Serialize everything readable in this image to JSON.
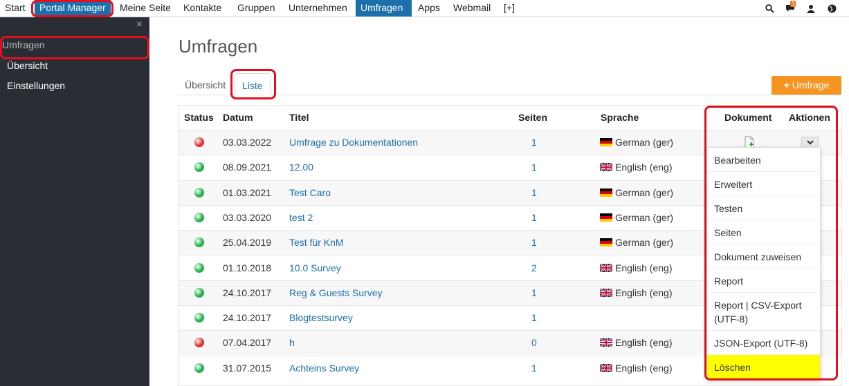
{
  "nav": {
    "items": [
      "Start",
      "Portal Manager",
      "Meine Seite",
      "Kontakte",
      "Gruppen",
      "Unternehmen",
      "Umfragen",
      "Apps",
      "Webmail",
      "[+]"
    ],
    "notification_count": "1",
    "icons": [
      "zoom-icon",
      "chat-icon",
      "user-icon",
      "globe-icon"
    ]
  },
  "sidebar": {
    "close": "×",
    "title": "Umfragen",
    "links": [
      "Übersicht",
      "Einstellungen"
    ]
  },
  "page": {
    "title": "Umfragen",
    "tabs": [
      "Übersicht",
      "Liste"
    ],
    "add_button": "Umfrage",
    "add_plus": "+"
  },
  "table": {
    "headers": [
      "Status",
      "Datum",
      "Titel",
      "Seiten",
      "Sprache",
      "Dokument",
      "Aktionen"
    ],
    "rows": [
      {
        "status": "red",
        "date": "03.03.2022",
        "title": "Umfrage zu Dokumentationen",
        "pages": "1",
        "lang": "German (ger)",
        "flag": "de"
      },
      {
        "status": "green",
        "date": "08.09.2021",
        "title": "12.00",
        "pages": "1",
        "lang": "English (eng)",
        "flag": "en"
      },
      {
        "status": "green",
        "date": "01.03.2021",
        "title": "Test Caro",
        "pages": "1",
        "lang": "German (ger)",
        "flag": "de"
      },
      {
        "status": "green",
        "date": "03.03.2020",
        "title": "test 2",
        "pages": "1",
        "lang": "German (ger)",
        "flag": "de"
      },
      {
        "status": "green",
        "date": "25.04.2019",
        "title": "Test für KnM",
        "pages": "1",
        "lang": "German (ger)",
        "flag": "de"
      },
      {
        "status": "green",
        "date": "01.10.2018",
        "title": "10.0 Survey",
        "pages": "2",
        "lang": "English (eng)",
        "flag": "en"
      },
      {
        "status": "green",
        "date": "24.10.2017",
        "title": "Reg & Guests Survey",
        "pages": "1",
        "lang": "English (eng)",
        "flag": "en"
      },
      {
        "status": "green",
        "date": "24.10.2017",
        "title": "Blogtestsurvey",
        "pages": "1",
        "lang": "",
        "flag": ""
      },
      {
        "status": "red",
        "date": "07.04.2017",
        "title": "h",
        "pages": "0",
        "lang": "English (eng)",
        "flag": "en"
      },
      {
        "status": "green",
        "date": "31.07.2015",
        "title": "Achteins Survey",
        "pages": "1",
        "lang": "English (eng)",
        "flag": "en"
      }
    ]
  },
  "dropdown": {
    "items": [
      "Bearbeiten",
      "Erweitert",
      "Testen",
      "Seiten",
      "Dokument zuweisen",
      "Report",
      "Report | CSV-Export (UTF-8)",
      "JSON-Export (UTF-8)",
      "Löschen"
    ]
  },
  "colors": {
    "accent": "#1b6faa",
    "orange": "#f59420",
    "status_red": "#e03030",
    "status_green": "#22b14c",
    "highlight_red": "#e0101e",
    "delete_highlight": "#ffff00"
  }
}
